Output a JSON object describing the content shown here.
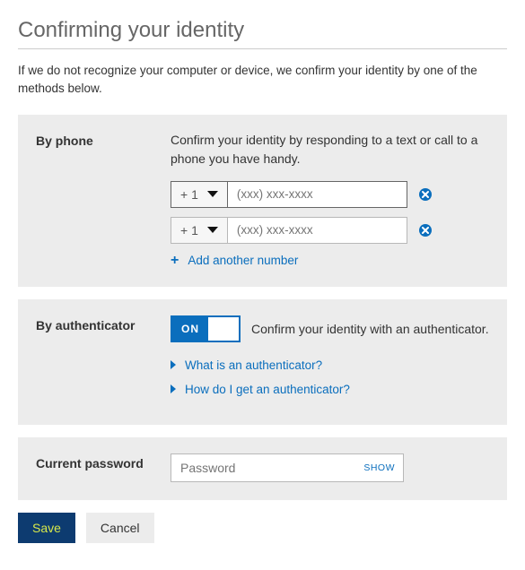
{
  "heading": "Confirming your identity",
  "intro": "If we do not recognize your computer or device, we confirm your identity by one of the methods below.",
  "phone": {
    "label": "By phone",
    "desc": "Confirm your identity by responding to a text or call to a phone you have handy.",
    "country_code": "+ 1",
    "placeholder": "(xxx) xxx-xxxx",
    "add_link": "Add another number"
  },
  "auth": {
    "label": "By authenticator",
    "toggle": "ON",
    "desc": "Confirm your identity with an authenticator.",
    "link1": "What is an authenticator?",
    "link2": "How do I get an authenticator?"
  },
  "password": {
    "label": "Current password",
    "placeholder": "Password",
    "show": "SHOW"
  },
  "actions": {
    "save": "Save",
    "cancel": "Cancel"
  }
}
